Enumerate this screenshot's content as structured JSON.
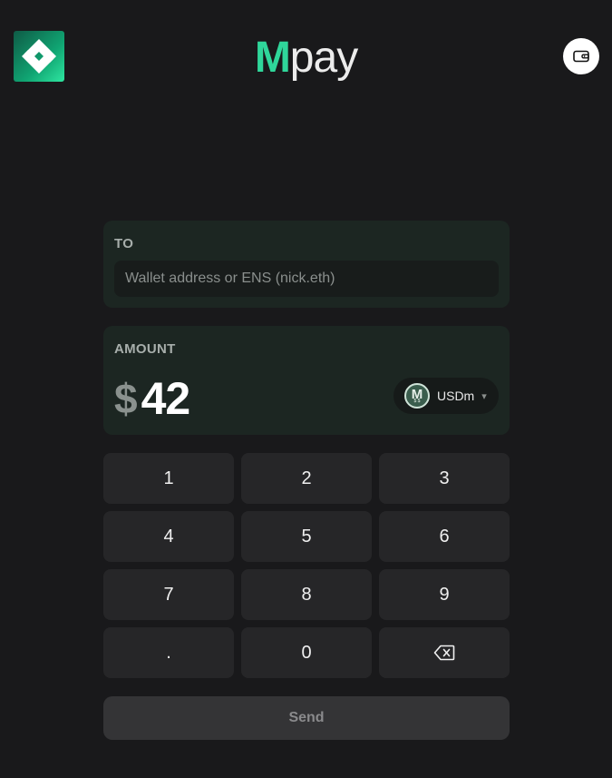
{
  "header": {
    "logo_icon": "app-logo-icon",
    "brand_m": "M",
    "brand_rest": "pay",
    "wallet_icon": "wallet-icon"
  },
  "to_card": {
    "label": "TO",
    "input_value": "",
    "input_placeholder": "Wallet address or ENS (nick.eth)"
  },
  "amount_card": {
    "label": "AMOUNT",
    "currency_symbol": "$",
    "amount": "42",
    "token": {
      "name": "USDm",
      "coin_letter": "M",
      "coin_sub": "$ $",
      "caret": "▾"
    }
  },
  "keypad": {
    "keys": [
      "1",
      "2",
      "3",
      "4",
      "5",
      "6",
      "7",
      "8",
      "9",
      ".",
      "0"
    ],
    "backspace_icon": "backspace-icon"
  },
  "send": {
    "label": "Send"
  },
  "colors": {
    "background": "#19191b",
    "accent": "#2fd69a",
    "card": "#1c2622",
    "key": "#262628"
  }
}
